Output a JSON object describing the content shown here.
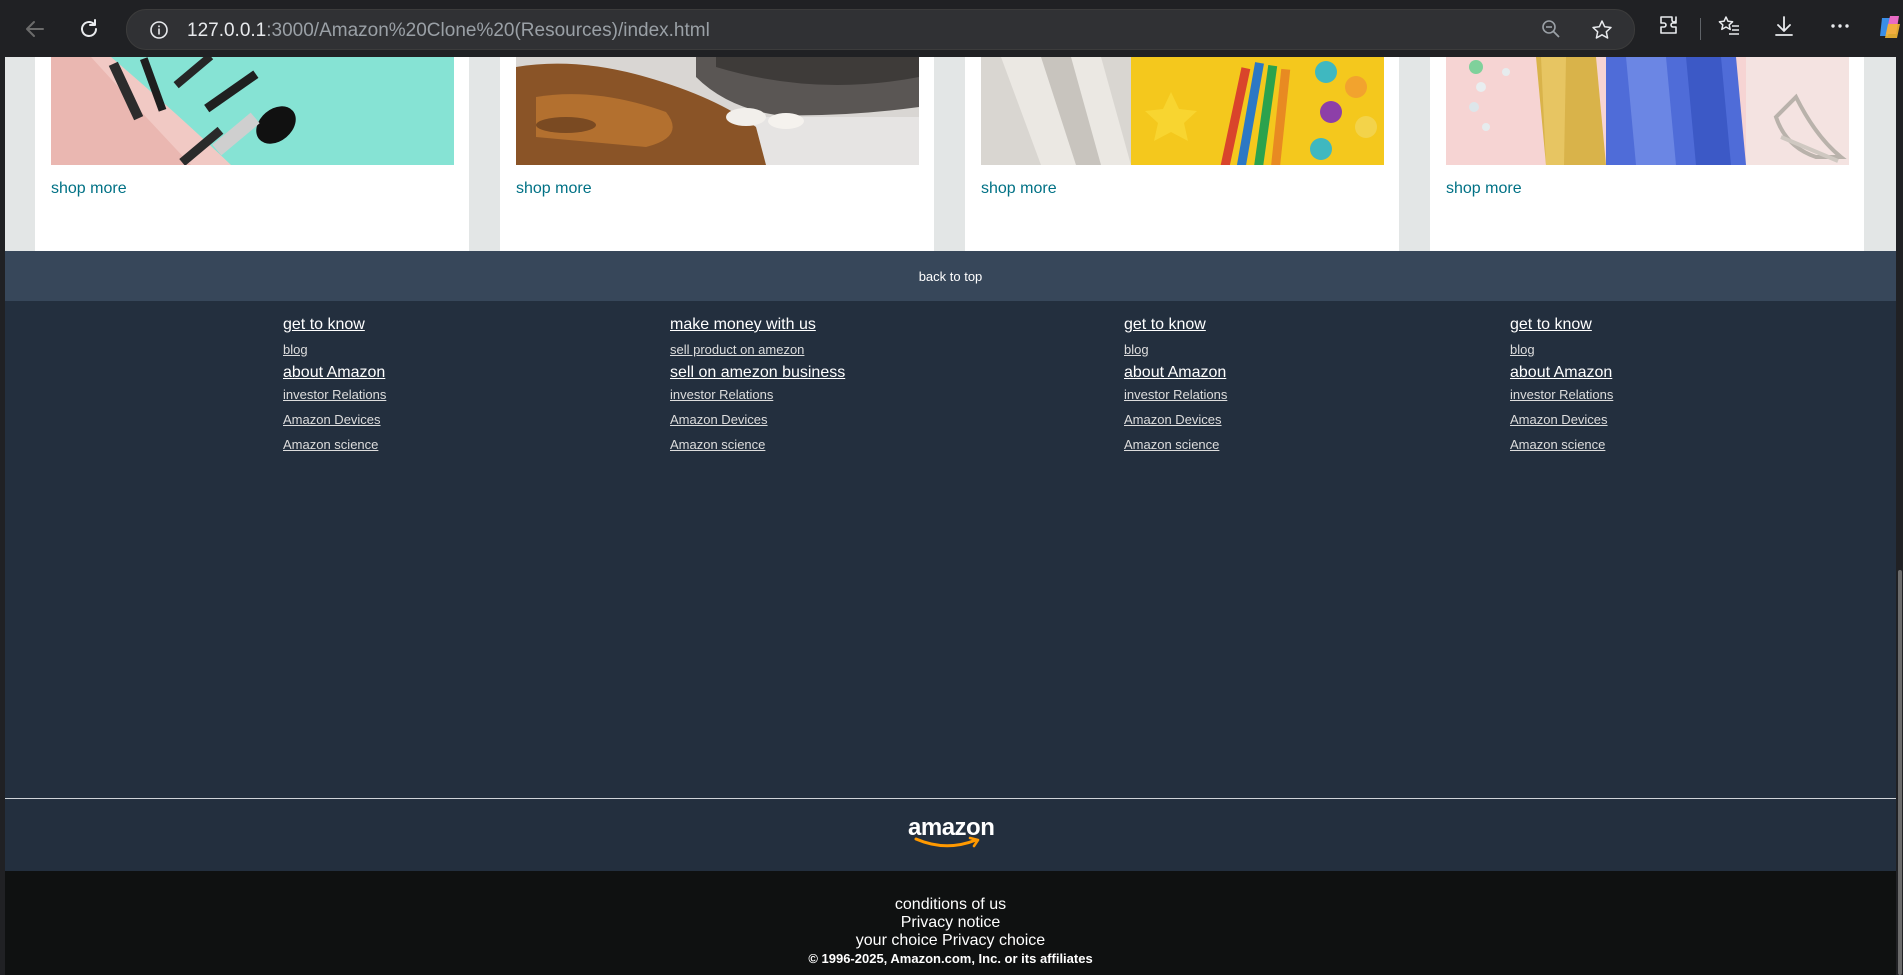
{
  "browser": {
    "url_host": "127.0.0.1",
    "url_rest": ":3000/Amazon%20Clone%20(Resources)/index.html"
  },
  "cards": [
    {
      "link": "shop more",
      "image": "beauty-makeup-image"
    },
    {
      "link": "shop more",
      "image": "pet-cat-image"
    },
    {
      "link": "shop more",
      "image": "school-supplies-image"
    },
    {
      "link": "shop more",
      "image": "fashion-image"
    }
  ],
  "back_to_top": "back to top",
  "footer": {
    "columns": [
      {
        "heading1": "get to know",
        "link1": "blog",
        "heading2": "about Amazon",
        "links": [
          "investor Relations",
          "Amazon Devices",
          "Amazon science"
        ]
      },
      {
        "heading1": "make money with us",
        "link1": "sell product on amezon",
        "heading2": "sell on amezon business",
        "links": [
          "investor Relations",
          "Amazon Devices",
          "Amazon science"
        ]
      },
      {
        "heading1": "get to know",
        "link1": "blog",
        "heading2": "about Amazon",
        "links": [
          "investor Relations",
          "Amazon Devices",
          "Amazon science"
        ]
      },
      {
        "heading1": "get to know",
        "link1": "blog",
        "heading2": "about Amazon",
        "links": [
          "investor Relations",
          "Amazon Devices",
          "Amazon science"
        ]
      }
    ],
    "logo": "amazon",
    "bottom": {
      "conditions": "conditions of us",
      "privacy": "Privacy notice",
      "choice": "your choice Privacy choice",
      "copyright": "© 1996-2025, Amazon.com, Inc. or its affiliates"
    }
  },
  "colors": {
    "link": "#007185",
    "back_to_top_bg": "#37475a",
    "footer_bg": "#232f3e",
    "footer_bottom_bg": "#0f1111",
    "smile": "#ff9900"
  }
}
